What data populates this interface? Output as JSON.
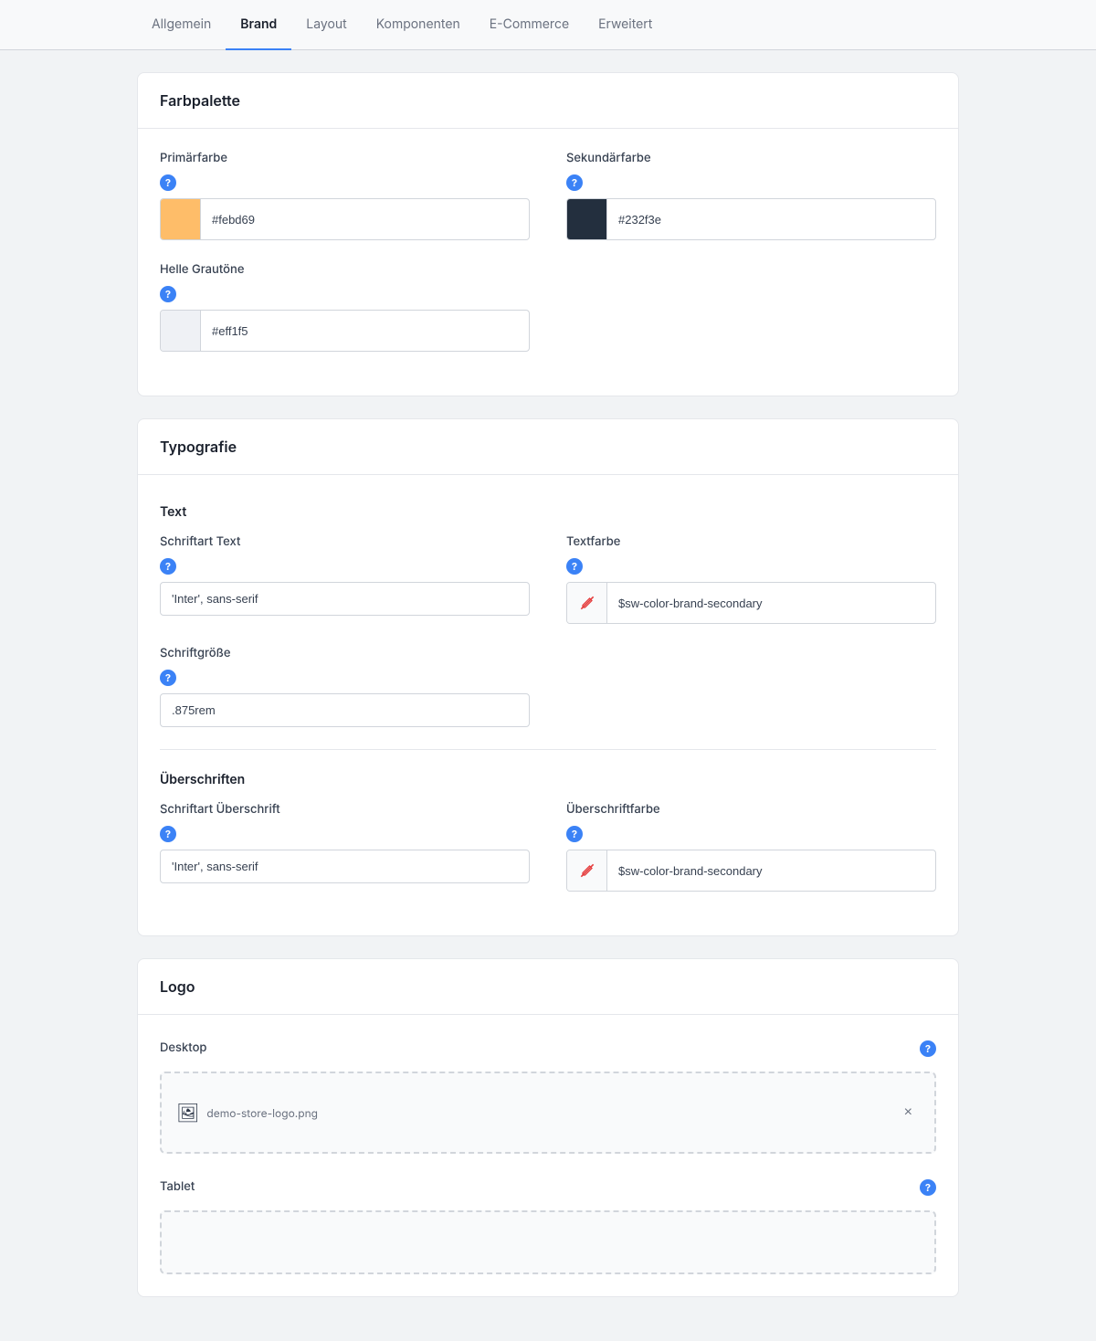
{
  "nav": {
    "tabs": [
      {
        "id": "allgemein",
        "label": "Allgemein",
        "active": false
      },
      {
        "id": "brand",
        "label": "Brand",
        "active": true
      },
      {
        "id": "layout",
        "label": "Layout",
        "active": false
      },
      {
        "id": "komponenten",
        "label": "Komponenten",
        "active": false
      },
      {
        "id": "ecommerce",
        "label": "E-Commerce",
        "active": false
      },
      {
        "id": "erweitert",
        "label": "Erweitert",
        "active": false
      }
    ]
  },
  "farbpalette": {
    "title": "Farbpalette",
    "primary": {
      "label": "Primärfarbe",
      "value": "#febd69",
      "color": "orange"
    },
    "secondary": {
      "label": "Sekundärfarbe",
      "value": "#232f3e",
      "color": "dark"
    },
    "light_gray": {
      "label": "Helle Grautöne",
      "value": "#eff1f5",
      "color": "light-gray"
    }
  },
  "typografie": {
    "title": "Typografie",
    "text_section": "Text",
    "font_text_label": "Schriftart Text",
    "font_text_value": "'Inter', sans-serif",
    "text_color_label": "Textfarbe",
    "text_color_value": "$sw-color-brand-secondary",
    "font_size_label": "Schriftgröße",
    "font_size_value": ".875rem",
    "headings_section": "Überschriften",
    "font_heading_label": "Schriftart Überschrift",
    "font_heading_value": "'Inter', sans-serif",
    "heading_color_label": "Überschriftfarbe",
    "heading_color_value": "$sw-color-brand-secondary"
  },
  "logo": {
    "title": "Logo",
    "desktop_label": "Desktop",
    "desktop_filename": "demo-store-logo.png",
    "tablet_label": "Tablet",
    "remove_label": "×"
  },
  "icons": {
    "help": "?",
    "edit": "✏",
    "remove": "×"
  }
}
